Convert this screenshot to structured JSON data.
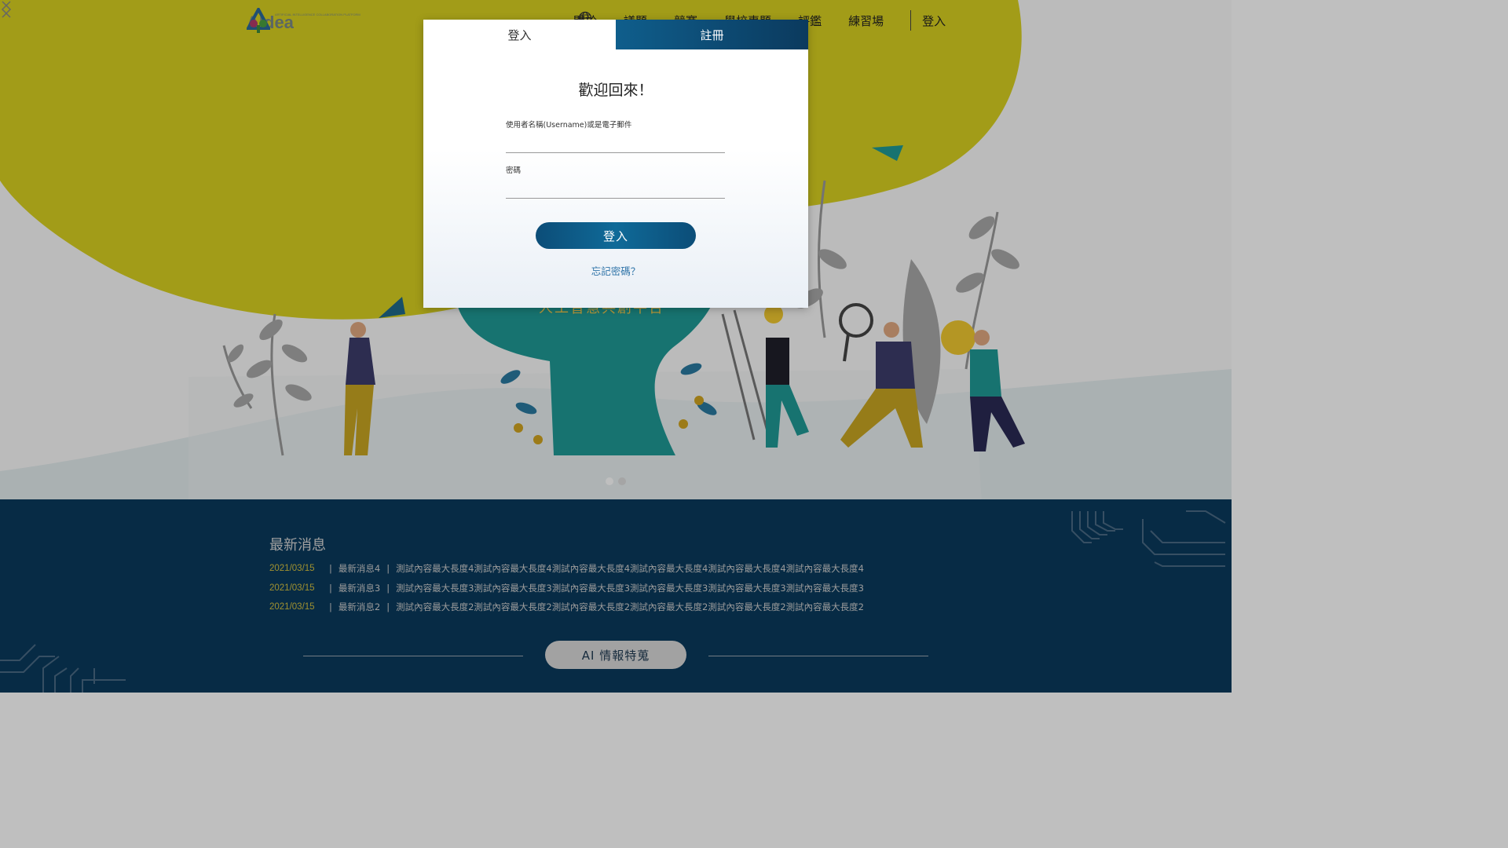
{
  "header": {
    "logo_text": "AIdea",
    "logo_small": "ARTIFICIAL INTELLIGENCE COLLABORATION PLATFORM",
    "nav": [
      "關於",
      "議題",
      "競賽",
      "學校專題",
      "評鑑",
      "練習場"
    ],
    "login": "登入",
    "globe_icon": "globe-icon"
  },
  "hero": {
    "subtitle": "人工智慧共創平台",
    "slides": 2,
    "active_slide": 1
  },
  "modal": {
    "tab_login": "登入",
    "tab_register": "註冊",
    "title": "歡迎回來！",
    "username_label": "使用者名稱(Username)或是電子郵件",
    "username_value": "",
    "password_label": "密碼",
    "password_value": "",
    "login_button": "登入",
    "forgot_password": "忘記密碼？"
  },
  "news": {
    "title": "最新消息",
    "items": [
      {
        "date": "2021/03/15",
        "name": "最新消息4",
        "content": "測試內容最大長度4測試內容最大長度4測試內容最大長度4測試內容最大長度4測試內容最大長度4測試內容最大長度4"
      },
      {
        "date": "2021/03/15",
        "name": "最新消息3",
        "content": "測試內容最大長度3測試內容最大長度3測試內容最大長度3測試內容最大長度3測試內容最大長度3測試內容最大長度3"
      },
      {
        "date": "2021/03/15",
        "name": "最新消息2",
        "content": "測試內容最大長度2測試內容最大長度2測試內容最大長度2測試內容最大長度2測試內容最大長度2測試內容最大長度2"
      }
    ],
    "separator": "|"
  },
  "ai_section": {
    "button": "AI 情報特蒐"
  },
  "colors": {
    "hero_yellow": "#d8d020",
    "teal": "#1f9a96",
    "navy": "#0a3a5c",
    "modal_blue": "#0f5e8c",
    "news_date": "#d4c040"
  }
}
